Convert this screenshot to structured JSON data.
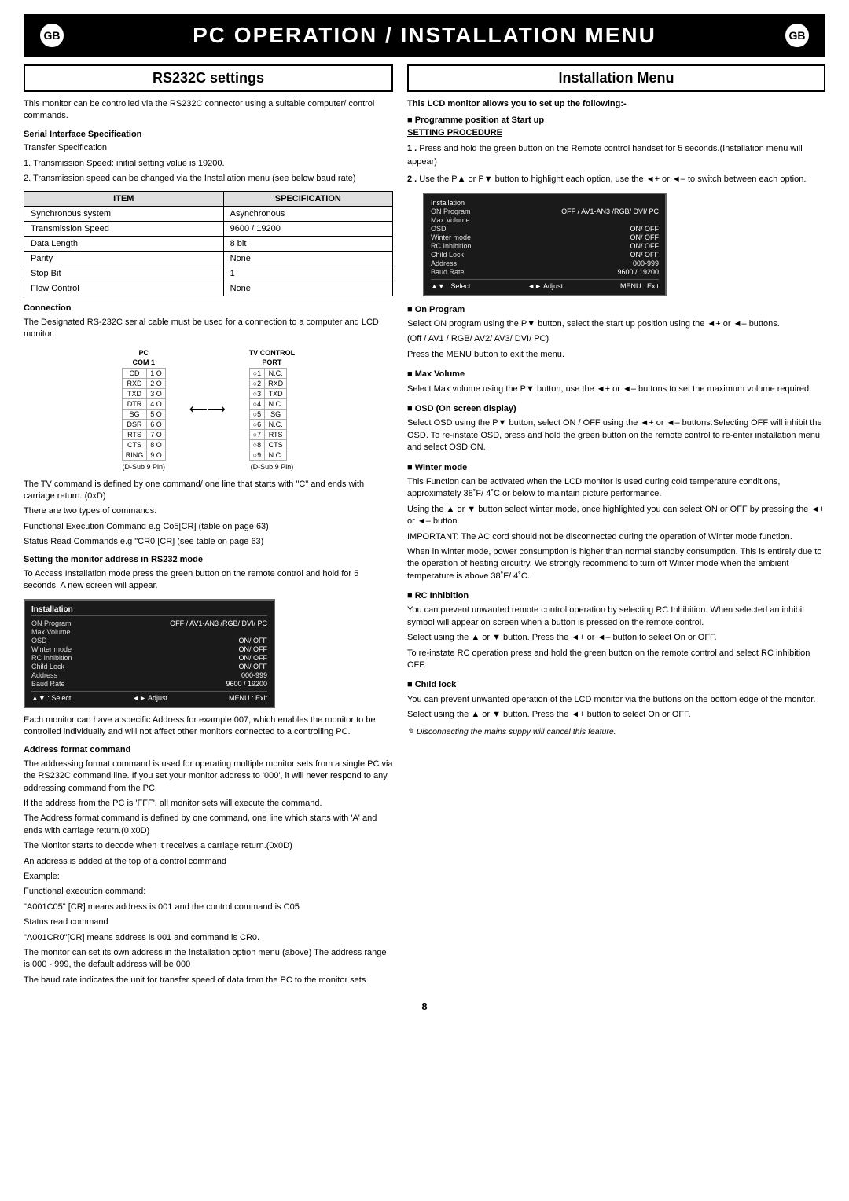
{
  "header": {
    "badge": "GB",
    "title": "PC OPERATION / INSTALLATION MENU"
  },
  "left": {
    "section_title": "RS232C settings",
    "intro": "This monitor can be controlled via the RS232C connector using a suitable computer/ control commands.",
    "serial_spec": {
      "heading": "Serial Interface Specification",
      "sub": "Transfer Specification",
      "items": [
        "1. Transmission Speed: initial setting value is 19200.",
        "2. Transmission speed can be changed via the Installation menu (see below baud rate)"
      ]
    },
    "spec_table": {
      "headers": [
        "ITEM",
        "SPECIFICATION"
      ],
      "rows": [
        [
          "Synchronous system",
          "Asynchronous"
        ],
        [
          "Transmission Speed",
          "9600 / 19200"
        ],
        [
          "Data Length",
          "8 bit"
        ],
        [
          "Parity",
          "None"
        ],
        [
          "Stop Bit",
          "1"
        ],
        [
          "Flow Control",
          "None"
        ]
      ]
    },
    "connection": {
      "heading": "Connection",
      "text": "The Designated RS-232C serial cable must be used for a connection to a computer and LCD monitor.",
      "pc_label": "PC",
      "com_label": "COM 1",
      "tv_label": "TV CONTROL",
      "port_label": "PORT",
      "dsub_left": "(D-Sub  9 Pin)",
      "dsub_right": "(D-Sub  9 Pin)",
      "rows": [
        [
          "CD",
          "1 O",
          "○1",
          "N.C."
        ],
        [
          "RXD",
          "2 O",
          "○2",
          "RXD"
        ],
        [
          "TXD",
          "3 O",
          "○3",
          "TXD"
        ],
        [
          "DTR",
          "4 O",
          "○4",
          "N.C."
        ],
        [
          "SG",
          "5 O",
          "○5",
          "SG"
        ],
        [
          "DSR",
          "6 O",
          "○6",
          "N.C."
        ],
        [
          "RTS",
          "7 O",
          "○7",
          "RTS"
        ],
        [
          "CTS",
          "8 O",
          "○8",
          "CTS"
        ],
        [
          "RING",
          "9 O",
          "○9",
          "N.C."
        ]
      ]
    },
    "commands_text": [
      "The TV command is defined by one command/ one line that starts with \"C\" and ends with carriage return. (0xD)",
      "",
      "There are two types of commands:",
      "Functional Execution Command  e.g Co5[CR] (table on page 63)",
      "Status Read Commands e.g \"CR0 [CR] (see table on page 63)"
    ],
    "rs232_mode": {
      "heading": "Setting the monitor address in RS232 mode",
      "text": "To Access Installation mode press the green button on the remote control and hold for 5 seconds. A new screen will appear."
    },
    "installation_screen": {
      "title": "Installation",
      "rows": [
        [
          "ON Program",
          "OFF / AV1-AN3 /RGB/ DVI/ PC"
        ],
        [
          "Max Volume",
          ""
        ],
        [
          "OSD",
          "ON/ OFF"
        ],
        [
          "Winter mode",
          "ON/ OFF"
        ],
        [
          "RC Inhibition",
          "ON/ OFF"
        ],
        [
          "Child Lock",
          "ON/ OFF"
        ],
        [
          "Address",
          "000-999"
        ],
        [
          "Baud Rate",
          "9600 / 19200"
        ]
      ],
      "footer": [
        "▲▼ : Select",
        "◄► Adjust",
        "MENU : Exit"
      ]
    },
    "address_text": "Each monitor can have a specific Address for example 007, which enables the monitor to be controlled individually and will not affect other monitors connected to a controlling PC.",
    "address_format": {
      "heading": "Address format command",
      "paragraphs": [
        "The addressing format command is used for operating multiple monitor sets from a single PC via the RS232C command line. If you set your monitor address to '000', it will never respond to any addressing command from the PC.",
        "If the address from the PC is 'FFF', all monitor sets will execute the command.",
        "The Address format command is defined by one command, one line which starts with 'A' and ends with carriage return.(0 x0D)",
        "The Monitor starts to decode when it receives a carriage return.(0x0D)",
        "An address is added at the top of a control command",
        "Example:",
        "Functional execution command:",
        "\"A001C05\" [CR] means address is  001 and the control command is C05",
        "Status read command",
        "\"A001CR0\"[CR] means address is 001 and command is CR0.",
        "",
        "The monitor can set its own address in the Installation option menu (above) The address range is 000 - 999, the default address will be 000",
        "The baud rate  indicates the unit for transfer speed of data from the PC to the monitor sets"
      ]
    }
  },
  "right": {
    "section_title": "Installation Menu",
    "intro_bold": "This LCD monitor  allows you to set up the following:-",
    "programme_heading": "Programme position at Start up",
    "programme_procedure": "SETTING PROCEDURE",
    "steps": [
      {
        "num": "1",
        "text": "Press and hold the green button  on the Remote control handset for 5 seconds.(Installation menu will appear)"
      },
      {
        "num": "2",
        "text": "Use the P▲ or P▼ button to highlight each option, use the ◄+ or ◄– to switch between each option."
      }
    ],
    "installation_screen": {
      "title": "Installation",
      "rows": [
        [
          "ON Program",
          "OFF / AV1-AN3 /RGB/ DVI/ PC"
        ],
        [
          "Max Volume",
          ""
        ],
        [
          "OSD",
          "ON/ OFF"
        ],
        [
          "Winter mode",
          "ON/ OFF"
        ],
        [
          "RC Inhibition",
          "ON/ OFF"
        ],
        [
          "Child Lock",
          "ON/ OFF"
        ],
        [
          "Address",
          "000-999"
        ],
        [
          "Baud Rate",
          "9600 / 19200"
        ]
      ],
      "footer": [
        "▲▼ : Select",
        "◄► Adjust",
        "MENU : Exit"
      ]
    },
    "subsections": [
      {
        "heading": "On Program",
        "bullet": true,
        "paragraphs": [
          "Select ON program using the P▼ button, select the start up position using the ◄+ or ◄– buttons.",
          "(Off / AV1 / RGB/ AV2/ AV3/ DVI/ PC)",
          "Press the MENU button to exit the menu."
        ]
      },
      {
        "heading": "Max Volume",
        "bullet": true,
        "paragraphs": [
          "Select Max volume using the P▼ button, use the ◄+ or ◄– buttons to set the maximum volume required."
        ]
      },
      {
        "heading": "OSD (On screen display)",
        "bullet": true,
        "paragraphs": [
          "Select OSD using the P▼ button, select ON / OFF using the ◄+ or ◄– buttons.Selecting OFF will inhibit the OSD. To re-instate OSD, press and hold the green button on the remote control to re-enter installation menu and select OSD ON."
        ]
      },
      {
        "heading": "Winter mode",
        "bullet": true,
        "paragraphs": [
          "This Function can be activated when the LCD monitor is used during cold temperature conditions, approximately 38˚F/ 4˚C or below to maintain picture performance.",
          "Using  the ▲ or ▼ button select winter mode, once highlighted you can select ON or OFF by pressing the ◄+ or ◄– button.",
          "IMPORTANT: The AC cord should not be disconnected during the operation of Winter mode function.",
          "When in winter mode, power consumption is higher than normal standby consumption. This is entirely due to the operation of heating circuitry. We strongly recommend to turn off Winter mode when the ambient temperature is above 38˚F/ 4˚C."
        ]
      },
      {
        "heading": "RC Inhibition",
        "bullet": true,
        "paragraphs": [
          "You can prevent unwanted remote control operation by selecting RC Inhibition. When selected an inhibit symbol will appear on screen when a button is pressed on the remote control.",
          "Select using the ▲ or ▼ button. Press the ◄+ or ◄– button to select On or OFF.",
          "To re-instate RC operation press and hold the green button on the remote control and select RC inhibition OFF."
        ]
      },
      {
        "heading": "Child lock",
        "bullet": true,
        "paragraphs": [
          "You can prevent unwanted operation of the LCD monitor via the buttons on the bottom edge of the monitor.",
          "Select using the ▲ or ▼ button. Press the ◄+ button to select On or OFF."
        ]
      }
    ],
    "note": "✎  Disconnecting the mains suppy will cancel this feature."
  },
  "page_number": "8"
}
